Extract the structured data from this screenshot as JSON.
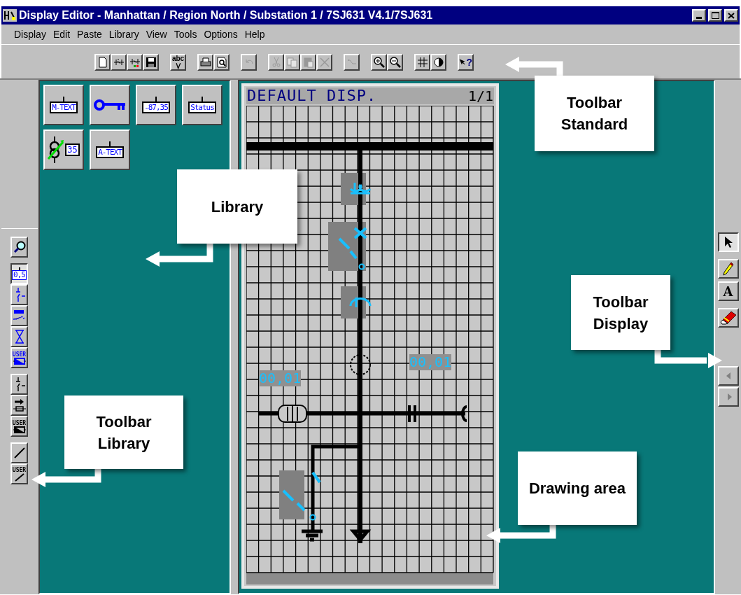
{
  "window": {
    "title": "Display Editor - Manhattan / Region North / Substation 1 / 7SJ631 V4.1/7SJ631"
  },
  "menu": [
    "Display",
    "Edit",
    "Paste",
    "Library",
    "View",
    "Tools",
    "Options",
    "Help"
  ],
  "toolbar_standard": [
    [
      {
        "kind": "new",
        "disabled": false
      },
      {
        "kind": "library",
        "disabled": false
      },
      {
        "kind": "library-colour",
        "disabled": false
      },
      {
        "kind": "save",
        "disabled": false
      }
    ],
    [
      {
        "kind": "spell",
        "label": "abc",
        "disabled": false
      }
    ],
    [
      {
        "kind": "print",
        "disabled": false
      },
      {
        "kind": "preview",
        "disabled": false
      }
    ],
    [
      {
        "kind": "undo",
        "disabled": true
      }
    ],
    [
      {
        "kind": "cut",
        "disabled": true
      },
      {
        "kind": "copy",
        "disabled": true
      },
      {
        "kind": "paste",
        "disabled": true
      },
      {
        "kind": "delete",
        "disabled": true
      }
    ],
    [
      {
        "kind": "route",
        "disabled": true
      }
    ],
    [
      {
        "kind": "zoom-in",
        "disabled": false
      },
      {
        "kind": "zoom-out",
        "disabled": false
      }
    ],
    [
      {
        "kind": "grid",
        "disabled": false
      },
      {
        "kind": "contrast",
        "disabled": false
      }
    ],
    [
      {
        "kind": "help",
        "label": "?",
        "disabled": false
      }
    ]
  ],
  "library": {
    "items": [
      {
        "kind": "text",
        "label": "M-TEXT"
      },
      {
        "kind": "key"
      },
      {
        "kind": "text",
        "label": "-87,35"
      },
      {
        "kind": "text",
        "label": "Status"
      },
      {
        "kind": "transformer",
        "label": "35"
      },
      {
        "kind": "text",
        "label": "A-TEXT"
      }
    ]
  },
  "toolbar_library": [
    [
      {
        "kind": "zoom",
        "pressed": false
      }
    ],
    [
      {
        "kind": "value",
        "label": "0,5",
        "pressed": true
      },
      {
        "kind": "switch",
        "pressed": false
      },
      {
        "kind": "switch-bar",
        "pressed": false
      },
      {
        "kind": "hourglass",
        "pressed": false
      },
      {
        "kind": "user",
        "label": "USER",
        "pressed": false
      }
    ],
    [
      {
        "kind": "switch-dark",
        "pressed": false
      },
      {
        "kind": "fuse",
        "pressed": false
      },
      {
        "kind": "user-dark",
        "label": "USER",
        "pressed": false
      }
    ],
    [
      {
        "kind": "line",
        "pressed": false
      },
      {
        "kind": "user-line",
        "label": "USER",
        "pressed": false
      }
    ]
  ],
  "toolbar_display": [
    {
      "kind": "pointer",
      "pressed": true
    },
    {
      "kind": "pencil",
      "pressed": false
    },
    {
      "kind": "letter",
      "label": "A",
      "pressed": false
    },
    {
      "kind": "eraser",
      "pressed": false
    }
  ],
  "scroll_buttons": [
    {
      "kind": "left",
      "disabled": true
    },
    {
      "kind": "right",
      "disabled": true
    }
  ],
  "canvas": {
    "title": "DEFAULT DISP.",
    "page": "1/1",
    "values": [
      "00,01",
      "00,01"
    ]
  },
  "callouts": [
    "Toolbar Standard",
    "Library",
    "Toolbar Display",
    "Toolbar Library",
    "Drawing area"
  ]
}
